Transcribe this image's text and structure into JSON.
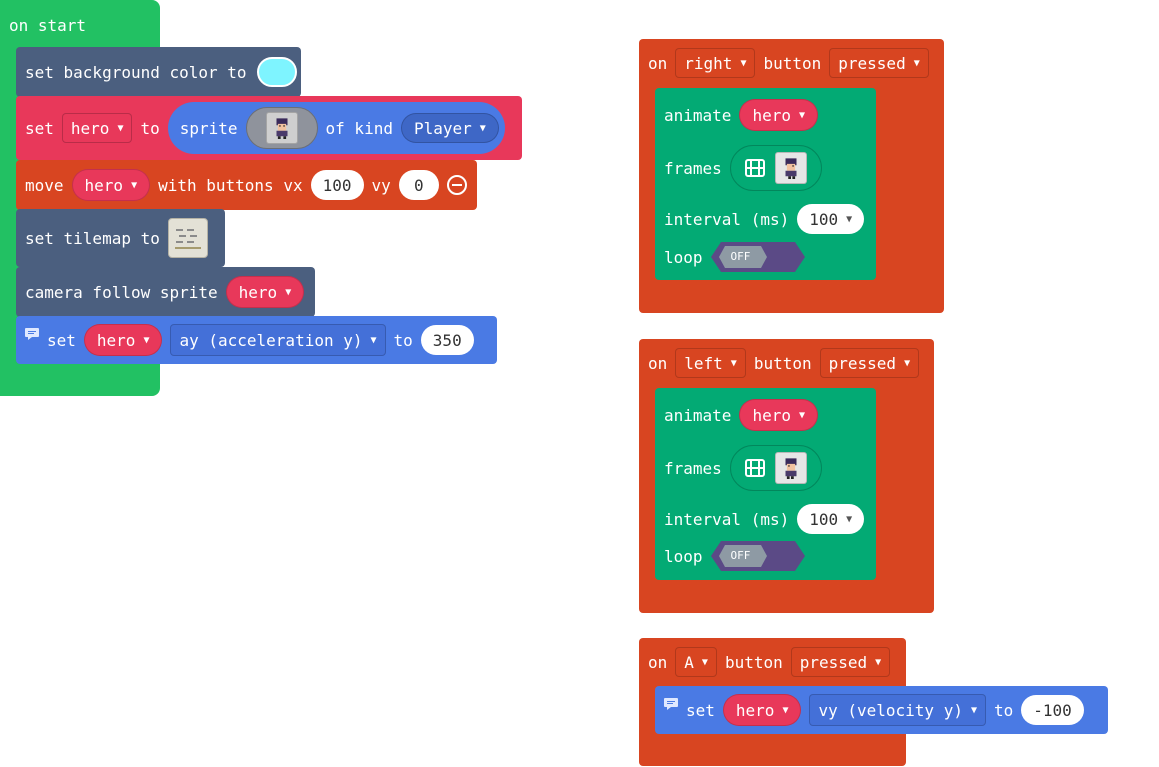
{
  "on_start": {
    "hat": "on start",
    "set_background": {
      "label": "set background color to",
      "color": "#7ef4ff"
    },
    "set_sprite": {
      "set": "set",
      "var": "hero",
      "to": "to",
      "sprite": "sprite",
      "of_kind": "of kind",
      "kind": "Player"
    },
    "move": {
      "move": "move",
      "var": "hero",
      "with_buttons_vx": "with buttons vx",
      "vx": "100",
      "vy_label": "vy",
      "vy": "0"
    },
    "set_tilemap": {
      "label": "set tilemap to"
    },
    "camera": {
      "label": "camera follow sprite",
      "var": "hero"
    },
    "set_accel": {
      "set": "set",
      "var": "hero",
      "prop": "ay (acceleration y)",
      "to": "to",
      "value": "350"
    }
  },
  "on_right": {
    "on": "on",
    "button": "right",
    "button_label": "button",
    "event": "pressed",
    "animate": "animate",
    "var": "hero",
    "frames": "frames",
    "interval_label": "interval (ms)",
    "interval": "100",
    "loop": "loop",
    "loop_state": "OFF"
  },
  "on_left": {
    "on": "on",
    "button": "left",
    "button_label": "button",
    "event": "pressed",
    "animate": "animate",
    "var": "hero",
    "frames": "frames",
    "interval_label": "interval (ms)",
    "interval": "100",
    "loop": "loop",
    "loop_state": "OFF"
  },
  "on_a": {
    "on": "on",
    "button": "A",
    "button_label": "button",
    "event": "pressed",
    "set": "set",
    "var": "hero",
    "prop": "vy (velocity y)",
    "to": "to",
    "value": "-100"
  },
  "icons": {
    "caret": "chevron-down-icon",
    "comment": "comment-icon",
    "remove": "minus-circle-icon",
    "film": "film-icon",
    "sprite": "sprite-image",
    "tilemap": "tilemap-image"
  }
}
